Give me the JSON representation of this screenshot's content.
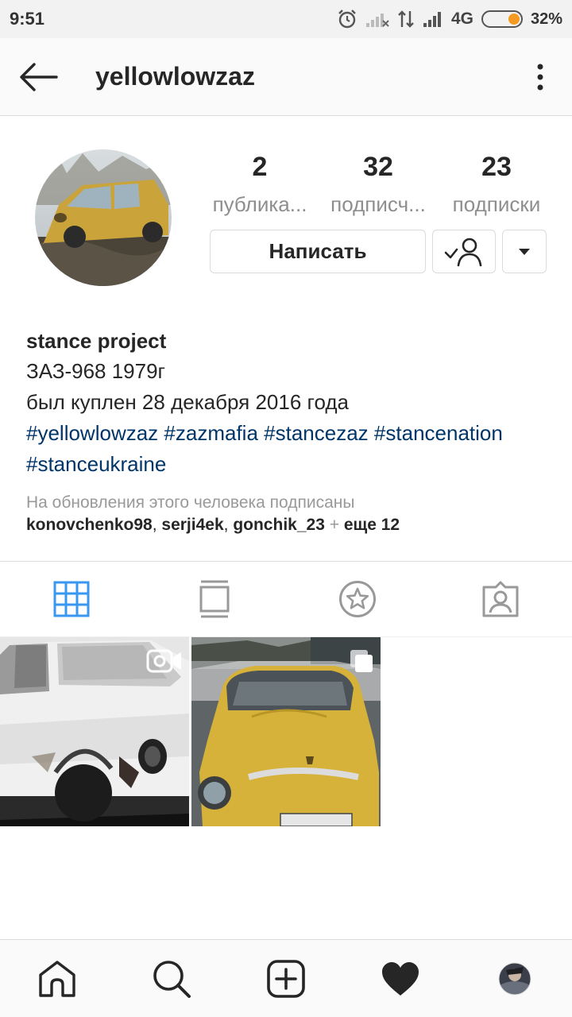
{
  "status_bar": {
    "time": "9:51",
    "network": "4G",
    "battery_percent": "32%",
    "battery_level": 0.32,
    "icons": [
      "alarm-icon",
      "signal-weak-icon",
      "data-arrows-icon",
      "signal-icon",
      "battery-icon"
    ]
  },
  "header": {
    "username": "yellowlowzaz"
  },
  "profile": {
    "stats": [
      {
        "value": "2",
        "label": "публика..."
      },
      {
        "value": "32",
        "label": "подписч..."
      },
      {
        "value": "23",
        "label": "подписки"
      }
    ],
    "message_label": "Написать"
  },
  "bio": {
    "name": "stance project",
    "lines": [
      "ЗАЗ-968 1979г",
      "был куплен 28 декабря 2016 года"
    ],
    "hashtags": [
      "#yellowlowzaz",
      "#zazmafia",
      "#stancezaz",
      "#stancenation",
      "#stanceukraine"
    ],
    "followed_note": "На обновления этого человека подписаны",
    "followers": [
      "konovchenko98",
      "serji4ek",
      "gonchik_23"
    ],
    "more": "еще 12"
  },
  "tabs": [
    "grid-icon",
    "feed-icon",
    "star-icon",
    "tagged-icon"
  ],
  "bottom_nav": [
    "home-icon",
    "search-icon",
    "add-post-icon",
    "heart-icon",
    "profile-avatar"
  ],
  "colors": {
    "accent_blue": "#3897f0",
    "hashtag": "#003569",
    "muted": "#8e8e8e",
    "border": "#dbdbdb"
  }
}
